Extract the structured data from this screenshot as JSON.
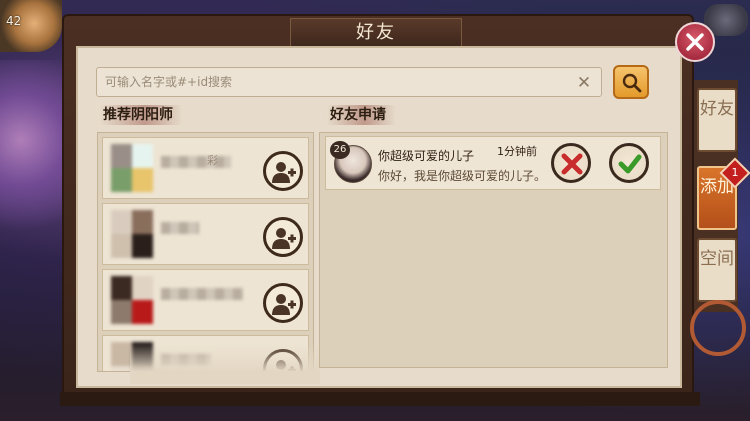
{
  "window": {
    "title": "好友"
  },
  "player": {
    "level": "42"
  },
  "search": {
    "placeholder": "可输入名字或#+id搜索"
  },
  "recommend": {
    "title": "推荐阴阳师",
    "items": [
      {
        "name_hint": "彩",
        "avatar_colors": [
          "#e6f4f0",
          "#7a9e6a",
          "#e8c46a",
          "#9a8f88"
        ]
      },
      {
        "name_hint": "",
        "avatar_colors": [
          "#cfc0ae",
          "#2a1f1a",
          "#8a6e5c",
          "#d9ccbe"
        ]
      },
      {
        "name_hint": "",
        "avatar_colors": [
          "#b81a1a",
          "#3b2a22",
          "#8d7a6c",
          "#e1d3c4"
        ]
      },
      {
        "name_hint": "",
        "avatar_colors": [
          "#2a2220",
          "#c9b8a4",
          "#6a5a4c",
          "#e8dccd"
        ]
      }
    ]
  },
  "requests": {
    "title": "好友申请",
    "items": [
      {
        "level": "26",
        "name": "你超级可爱的儿子",
        "time": "1分钟前",
        "message": "你好，我是你超级可爱的儿子。"
      }
    ]
  },
  "tabs": [
    {
      "label": "好友",
      "active": false
    },
    {
      "label": "添加",
      "active": true,
      "badge": "1"
    },
    {
      "label": "空间",
      "active": false
    }
  ]
}
